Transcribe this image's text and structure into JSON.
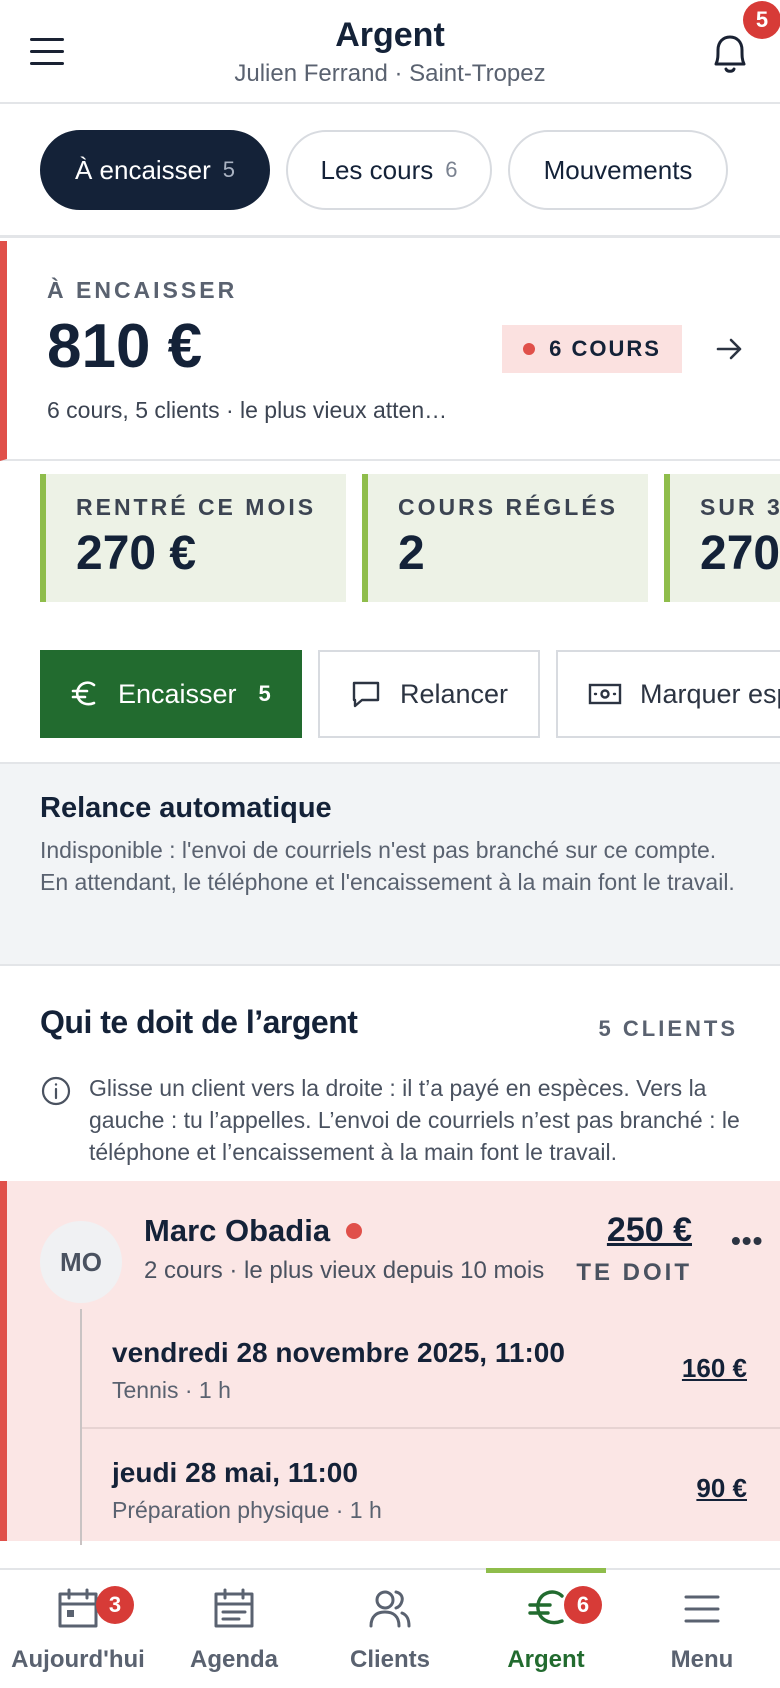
{
  "header": {
    "title": "Argent",
    "subtitle": "Julien Ferrand · Saint-Tropez",
    "notifications_count": "5"
  },
  "tabs": [
    {
      "label": "À encaisser",
      "count": "5",
      "active": true
    },
    {
      "label": "Les cours",
      "count": "6",
      "active": false
    },
    {
      "label": "Mouvements",
      "count": "",
      "active": false
    }
  ],
  "summary": {
    "label": "À ENCAISSER",
    "amount": "810 €",
    "description": "6 cours, 5 clients · le plus vieux atten…",
    "pill": "6 COURS"
  },
  "stats": [
    {
      "label": "RENTRÉ CE MOIS",
      "value": "270 €"
    },
    {
      "label": "COURS RÉGLÉS",
      "value": "2"
    },
    {
      "label": "SUR 3",
      "value": "270"
    }
  ],
  "actions": {
    "collect_label": "Encaisser",
    "collect_count": "5",
    "remind_label": "Relancer",
    "cash_label": "Marquer esp"
  },
  "relance": {
    "title": "Relance automatique",
    "body": "Indisponible : l'envoi de courriels n'est pas branché sur ce compte. En attendant, le téléphone et l'encaissement à la main font le travail."
  },
  "debtors": {
    "title": "Qui te doit de l’argent",
    "count": "5 CLIENTS",
    "hint": "Glisse un client vers la droite : il t’a payé en espèces. Vers la gauche : tu l’appelles. L’envoi de courriels n’est pas branché : le téléphone et l’encaissement à la main font le travail."
  },
  "client": {
    "initials": "MO",
    "name": "Marc Obadia",
    "detail": "2 cours · le plus vieux depuis 10 mois",
    "amount": "250 €",
    "due_label": "TE DOIT",
    "lessons": [
      {
        "date": "vendredi 28 novembre 2025, 11:00",
        "detail": "Tennis · 1 h",
        "amount": "160 €"
      },
      {
        "date": "jeudi 28 mai, 11:00",
        "detail": "Préparation physique · 1 h",
        "amount": "90 €"
      }
    ]
  },
  "bottom_nav": [
    {
      "label": "Aujourd'hui",
      "icon": "calendar-today-icon",
      "badge": "3"
    },
    {
      "label": "Agenda",
      "icon": "calendar-icon",
      "badge": ""
    },
    {
      "label": "Clients",
      "icon": "users-icon",
      "badge": ""
    },
    {
      "label": "Argent",
      "icon": "euro-icon",
      "badge": "6",
      "active": true
    },
    {
      "label": "Menu",
      "icon": "menu-icon",
      "badge": ""
    }
  ],
  "colors": {
    "navy": "#142238",
    "alert_red": "#e0504a",
    "primary_green": "#226b2f",
    "accent_lime": "#8fbd4b"
  }
}
